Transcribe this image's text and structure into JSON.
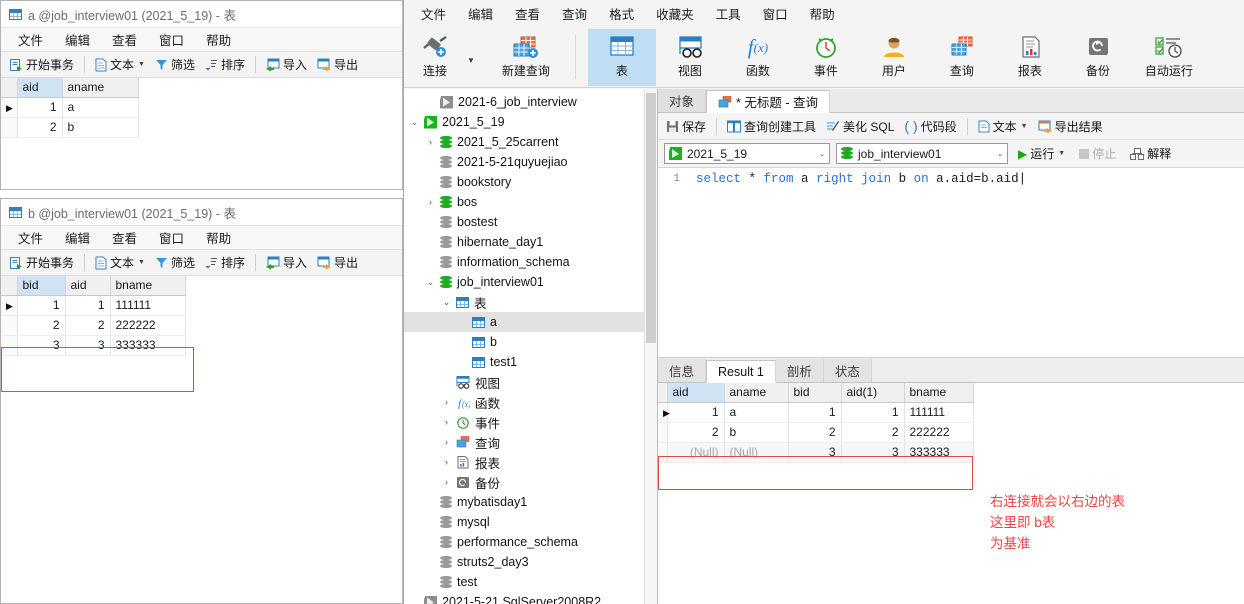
{
  "windows": {
    "table_a": {
      "title": "a @job_interview01 (2021_5_19) - 表",
      "menu": [
        "文件",
        "编辑",
        "查看",
        "窗口",
        "帮助"
      ],
      "toolbar": [
        "开始事务",
        "文本",
        "筛选",
        "排序",
        "导入",
        "导出"
      ],
      "columns": [
        "aid",
        "aname"
      ],
      "rows": [
        {
          "marked": true,
          "cells": [
            "1",
            "a"
          ]
        },
        {
          "marked": false,
          "cells": [
            "2",
            "b"
          ]
        }
      ]
    },
    "table_b": {
      "title": "b @job_interview01 (2021_5_19) - 表",
      "menu": [
        "文件",
        "编辑",
        "查看",
        "窗口",
        "帮助"
      ],
      "toolbar": [
        "开始事务",
        "文本",
        "筛选",
        "排序",
        "导入",
        "导出"
      ],
      "columns": [
        "bid",
        "aid",
        "bname"
      ],
      "rows": [
        {
          "marked": true,
          "cells": [
            "1",
            "1",
            "111111"
          ]
        },
        {
          "marked": false,
          "cells": [
            "2",
            "2",
            "222222"
          ]
        },
        {
          "marked": false,
          "cells": [
            "3",
            "3",
            "333333"
          ]
        }
      ]
    }
  },
  "main": {
    "menu": [
      "文件",
      "编辑",
      "查看",
      "查询",
      "格式",
      "收藏夹",
      "工具",
      "窗口",
      "帮助"
    ],
    "ribbon": [
      {
        "label": "连接",
        "icon": "plug-plus-icon",
        "dropdown": true
      },
      {
        "label": "新建查询",
        "icon": "new-query-icon",
        "dropdown": false
      },
      {
        "label": "表",
        "icon": "table-icon",
        "active": true
      },
      {
        "label": "视图",
        "icon": "view-icon",
        "active": false
      },
      {
        "label": "函数",
        "icon": "function-icon",
        "active": false
      },
      {
        "label": "事件",
        "icon": "event-clock-icon",
        "active": false
      },
      {
        "label": "用户",
        "icon": "user-icon",
        "active": false
      },
      {
        "label": "查询",
        "icon": "query-icon",
        "active": false
      },
      {
        "label": "报表",
        "icon": "report-icon",
        "active": false
      },
      {
        "label": "备份",
        "icon": "backup-icon",
        "active": false
      },
      {
        "label": "自动运行",
        "icon": "autorun-icon",
        "active": false
      }
    ],
    "tree": [
      {
        "label": "2021-6_job_interview",
        "icon": "connection-icon",
        "indent": 1,
        "expander": "",
        "color": "gray"
      },
      {
        "label": "2021_5_19",
        "icon": "connection-icon",
        "indent": 0,
        "expander": "v",
        "color": "green"
      },
      {
        "label": "2021_5_25carrent",
        "icon": "database-icon",
        "indent": 1,
        "expander": ">",
        "color": "green"
      },
      {
        "label": "2021-5-21quyuejiao",
        "icon": "database-icon",
        "indent": 1,
        "expander": "",
        "color": "gray"
      },
      {
        "label": "bookstory",
        "icon": "database-icon",
        "indent": 1,
        "expander": "",
        "color": "gray"
      },
      {
        "label": "bos",
        "icon": "database-icon",
        "indent": 1,
        "expander": ">",
        "color": "green"
      },
      {
        "label": "bostest",
        "icon": "database-icon",
        "indent": 1,
        "expander": "",
        "color": "gray"
      },
      {
        "label": "hibernate_day1",
        "icon": "database-icon",
        "indent": 1,
        "expander": "",
        "color": "gray"
      },
      {
        "label": "information_schema",
        "icon": "database-icon",
        "indent": 1,
        "expander": "",
        "color": "gray"
      },
      {
        "label": "job_interview01",
        "icon": "database-icon",
        "indent": 1,
        "expander": "v",
        "color": "green"
      },
      {
        "label": "表",
        "icon": "table-folder-icon",
        "indent": 2,
        "expander": "v",
        "color": "blue"
      },
      {
        "label": "a",
        "icon": "table-icon",
        "indent": 3,
        "expander": "",
        "color": "blue",
        "selected": true
      },
      {
        "label": "b",
        "icon": "table-icon",
        "indent": 3,
        "expander": "",
        "color": "blue"
      },
      {
        "label": "test1",
        "icon": "table-icon",
        "indent": 3,
        "expander": "",
        "color": "blue"
      },
      {
        "label": "视图",
        "icon": "view-icon",
        "indent": 2,
        "expander": "",
        "color": "blue"
      },
      {
        "label": "函数",
        "icon": "function-icon",
        "indent": 2,
        "expander": ">",
        "color": "blue"
      },
      {
        "label": "事件",
        "icon": "event-clock-icon",
        "indent": 2,
        "expander": ">",
        "color": "green"
      },
      {
        "label": "查询",
        "icon": "query-icon",
        "indent": 2,
        "expander": ">",
        "color": "blue"
      },
      {
        "label": "报表",
        "icon": "report-icon",
        "indent": 2,
        "expander": ">",
        "color": "gray"
      },
      {
        "label": "备份",
        "icon": "backup-icon",
        "indent": 2,
        "expander": ">",
        "color": "gray"
      },
      {
        "label": "mybatisday1",
        "icon": "database-icon",
        "indent": 1,
        "expander": "",
        "color": "gray"
      },
      {
        "label": "mysql",
        "icon": "database-icon",
        "indent": 1,
        "expander": "",
        "color": "gray"
      },
      {
        "label": "performance_schema",
        "icon": "database-icon",
        "indent": 1,
        "expander": "",
        "color": "gray"
      },
      {
        "label": "struts2_day3",
        "icon": "database-icon",
        "indent": 1,
        "expander": "",
        "color": "gray"
      },
      {
        "label": "test",
        "icon": "database-icon",
        "indent": 1,
        "expander": "",
        "color": "gray"
      },
      {
        "label": "2021-5-21 SqlServer2008R2",
        "icon": "connection-icon",
        "indent": 0,
        "expander": "",
        "color": "gray"
      }
    ],
    "editor_tabs": [
      {
        "label": "对象",
        "active": false,
        "icon": ""
      },
      {
        "label": "* 无标题 - 查询",
        "active": true,
        "icon": "query-icon"
      }
    ],
    "query_toolbar": [
      "保存",
      "查询创建工具",
      "美化 SQL",
      "( ) 代码段",
      "文本",
      "导出结果"
    ],
    "connection_select": "2021_5_19",
    "database_select": "job_interview01",
    "run_buttons": [
      "运行",
      "停止",
      "解释"
    ],
    "sql": {
      "line_number": "1",
      "tokens": [
        {
          "t": "select",
          "kw": true
        },
        {
          "t": " * ",
          "kw": false
        },
        {
          "t": "from",
          "kw": true
        },
        {
          "t": " a ",
          "kw": false
        },
        {
          "t": "right join",
          "kw": true
        },
        {
          "t": " b ",
          "kw": false
        },
        {
          "t": "on",
          "kw": true
        },
        {
          "t": " a.aid=b.aid",
          "kw": false
        }
      ],
      "text": "select * from a right join b on a.aid=b.aid"
    },
    "result_tabs": [
      {
        "label": "信息",
        "active": false
      },
      {
        "label": "Result 1",
        "active": true
      },
      {
        "label": "剖析",
        "active": false
      },
      {
        "label": "状态",
        "active": false
      }
    ],
    "result_grid": {
      "columns": [
        "aid",
        "aname",
        "bid",
        "aid(1)",
        "bname"
      ],
      "rows": [
        {
          "marked": true,
          "cells": [
            "1",
            "a",
            "1",
            "1",
            "111111"
          ],
          "null_cells": []
        },
        {
          "marked": false,
          "cells": [
            "2",
            "b",
            "2",
            "2",
            "222222"
          ],
          "null_cells": []
        },
        {
          "marked": false,
          "cells": [
            "(Null)",
            "(Null)",
            "3",
            "3",
            "333333"
          ],
          "null_cells": [
            0,
            1
          ]
        }
      ]
    },
    "annotation": "右连接就会以右边的表\n这里即 b表\n为基准"
  },
  "colors": {
    "accent": "#2b7fc4",
    "green": "#1eaa23",
    "annotation": "#ee4444",
    "highlight_box": "#e04a4a",
    "selection": "#cfe3f5"
  }
}
